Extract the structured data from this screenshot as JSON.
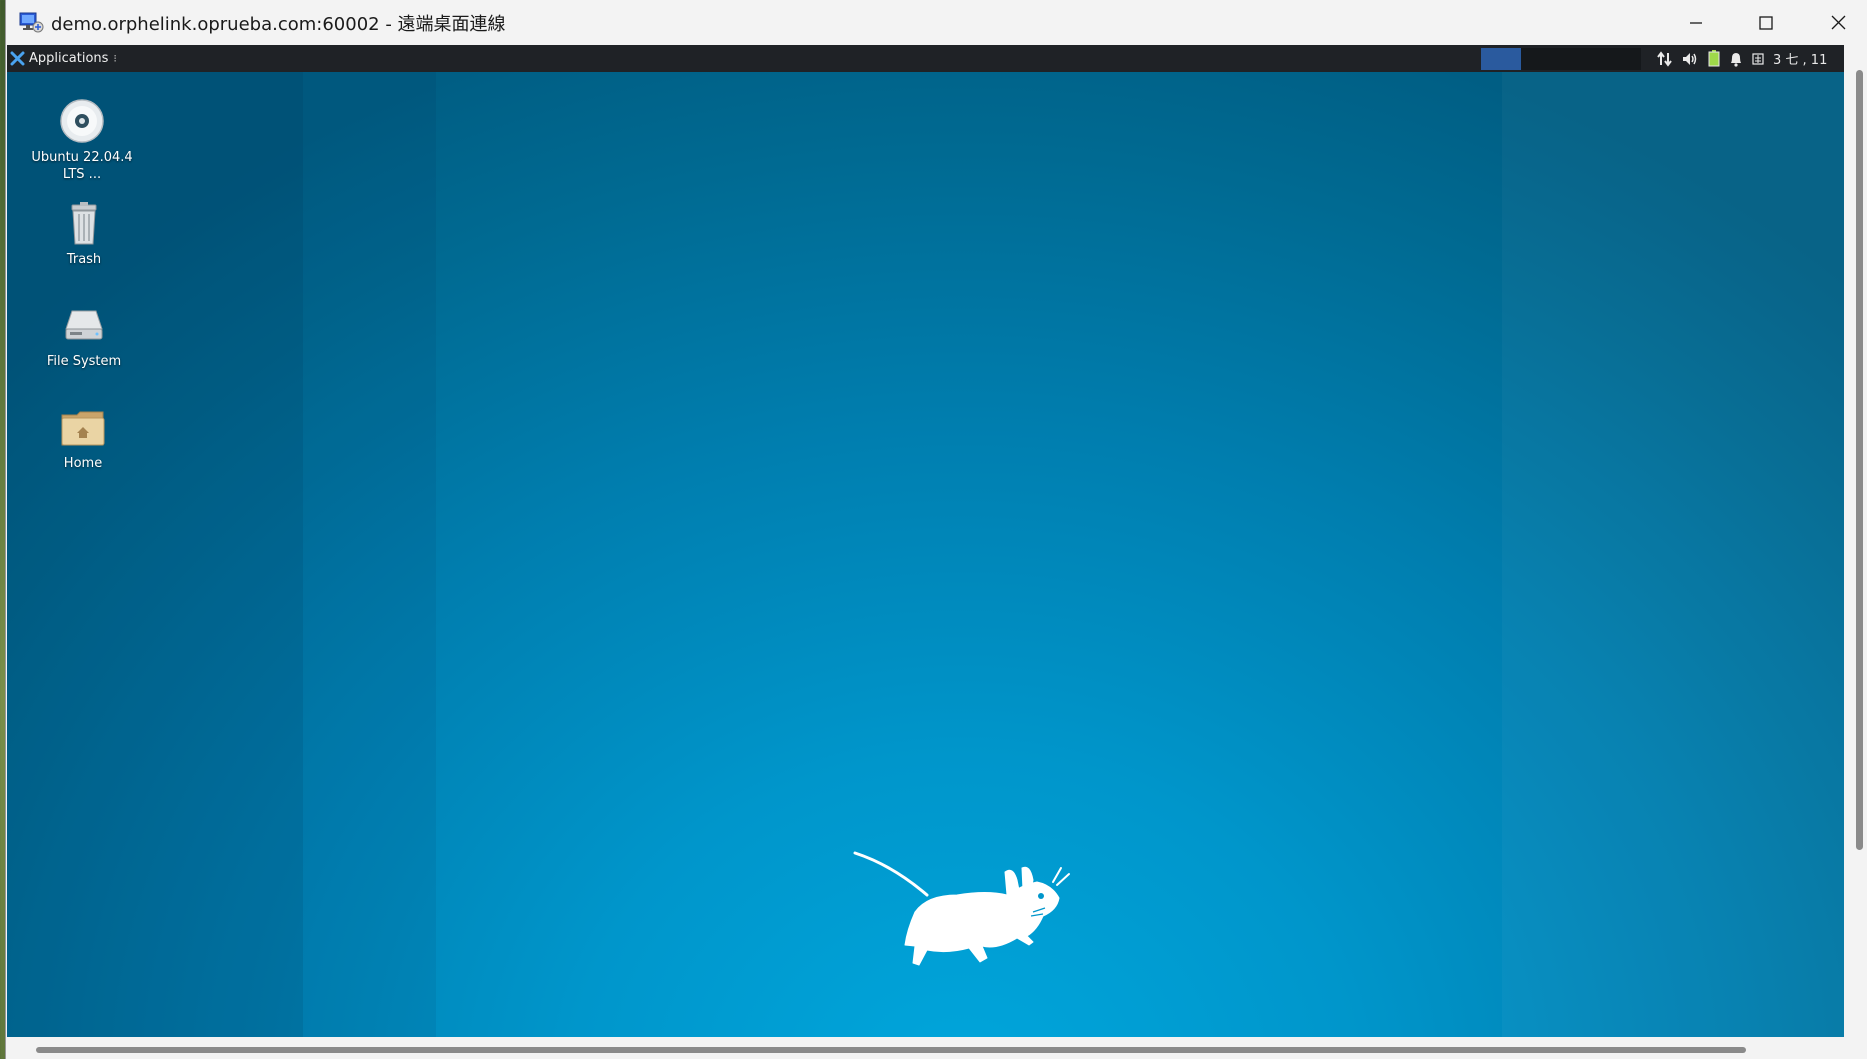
{
  "window": {
    "title": "demo.orphelink.oprueba.com:60002 - 遠端桌面連線"
  },
  "panel": {
    "applications_label": "Applications",
    "tray_text": "3 七 , 11"
  },
  "desktop": {
    "icons": [
      {
        "label": "Ubuntu 22.04.4 LTS ..."
      },
      {
        "label": "Trash"
      },
      {
        "label": "File System"
      },
      {
        "label": "Home"
      }
    ]
  }
}
